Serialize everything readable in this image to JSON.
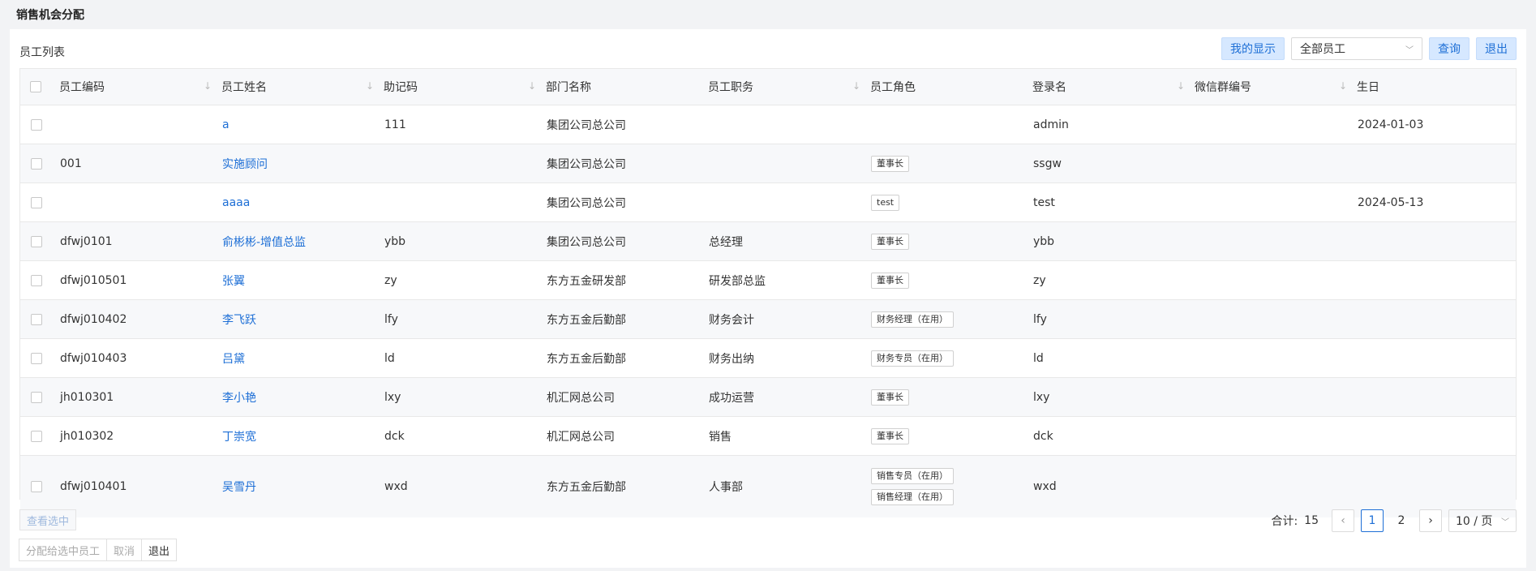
{
  "page": {
    "title": "销售机会分配"
  },
  "panel": {
    "title": "员工列表"
  },
  "toolbar": {
    "my_display": "我的显示",
    "employee_filter": "全部员工",
    "query": "查询",
    "exit": "退出"
  },
  "table": {
    "headers": [
      "员工编码",
      "员工姓名",
      "助记码",
      "部门名称",
      "员工职务",
      "员工角色",
      "登录名",
      "微信群编号",
      "生日"
    ],
    "rows": [
      {
        "code": "",
        "name": "a",
        "mnemonic": "111",
        "dept": "集团公司总公司",
        "position": "",
        "roles": [],
        "login": "admin",
        "wechat": "",
        "birthday": "2024-01-03"
      },
      {
        "code": "001",
        "name": "实施顾问",
        "mnemonic": "",
        "dept": "集团公司总公司",
        "position": "",
        "roles": [
          "董事长"
        ],
        "login": "ssgw",
        "wechat": "",
        "birthday": ""
      },
      {
        "code": "",
        "name": "aaaa",
        "mnemonic": "",
        "dept": "集团公司总公司",
        "position": "",
        "roles": [
          "test"
        ],
        "login": "test",
        "wechat": "",
        "birthday": "2024-05-13"
      },
      {
        "code": "dfwj0101",
        "name": "俞彬彬-增值总监",
        "mnemonic": "ybb",
        "dept": "集团公司总公司",
        "position": "总经理",
        "roles": [
          "董事长"
        ],
        "login": "ybb",
        "wechat": "",
        "birthday": ""
      },
      {
        "code": "dfwj010501",
        "name": "张翼",
        "mnemonic": "zy",
        "dept": "东方五金研发部",
        "position": "研发部总监",
        "roles": [
          "董事长"
        ],
        "login": "zy",
        "wechat": "",
        "birthday": ""
      },
      {
        "code": "dfwj010402",
        "name": "李飞跃",
        "mnemonic": "lfy",
        "dept": "东方五金后勤部",
        "position": "财务会计",
        "roles": [
          "财务经理（在用）"
        ],
        "login": "lfy",
        "wechat": "",
        "birthday": ""
      },
      {
        "code": "dfwj010403",
        "name": "吕黛",
        "mnemonic": "ld",
        "dept": "东方五金后勤部",
        "position": "财务出纳",
        "roles": [
          "财务专员（在用）"
        ],
        "login": "ld",
        "wechat": "",
        "birthday": ""
      },
      {
        "code": "jh010301",
        "name": "李小艳",
        "mnemonic": "lxy",
        "dept": "机汇网总公司",
        "position": "成功运营",
        "roles": [
          "董事长"
        ],
        "login": "lxy",
        "wechat": "",
        "birthday": ""
      },
      {
        "code": "jh010302",
        "name": "丁崇宽",
        "mnemonic": "dck",
        "dept": "机汇网总公司",
        "position": "销售",
        "roles": [
          "董事长"
        ],
        "login": "dck",
        "wechat": "",
        "birthday": ""
      },
      {
        "code": "dfwj010401",
        "name": "吴雪丹",
        "mnemonic": "wxd",
        "dept": "东方五金后勤部",
        "position": "人事部",
        "roles": [
          "销售专员（在用）",
          "销售经理（在用）"
        ],
        "login": "wxd",
        "wechat": "",
        "birthday": ""
      }
    ]
  },
  "footer": {
    "view_selected": "查看选中",
    "assign": "分配给选中员工",
    "cancel": "取消",
    "exit": "退出"
  },
  "pagination": {
    "total_label": "合计:",
    "total": "15",
    "pages": [
      "1",
      "2"
    ],
    "current": "1",
    "page_size": "10 / 页"
  }
}
